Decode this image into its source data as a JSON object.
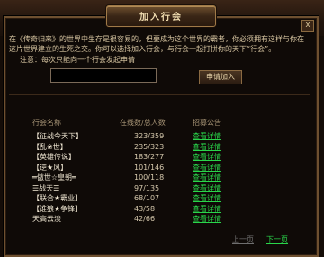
{
  "dialog": {
    "title": "加入行会",
    "close_label": "x",
    "intro_text": "在《传奇归来》的世界中生存是很容易的，但要成为这个世界的霸者，你必须拥有这样与你在这片世界建立的生死之交。你可以选择加入行会，与行会一起打拼你的天下“行会”。",
    "notice_text": "注意：每次只能向一个行会发起申请"
  },
  "application": {
    "input_value": "",
    "button_label": "申请加入"
  },
  "table": {
    "headers": {
      "name": "行会名称",
      "count": "在线数/总人数",
      "announcement": "招募公告"
    },
    "rows": [
      {
        "name": "【征战今天下】",
        "count": "323/359",
        "link": "查看详情"
      },
      {
        "name": "【乱❀世】",
        "count": "235/323",
        "link": "查看详情"
      },
      {
        "name": "【英雄传说】",
        "count": "183/277",
        "link": "查看详情"
      },
      {
        "name": "【逆★风】",
        "count": "101/146",
        "link": "查看详情"
      },
      {
        "name": "═傲世☆皇朝═",
        "count": "100/118",
        "link": "查看详情"
      },
      {
        "name": "☰战天☰",
        "count": "97/135",
        "link": "查看详情"
      },
      {
        "name": "【联合★霸业】",
        "count": "68/107",
        "link": "查看详情"
      },
      {
        "name": "【谁狼★争锋】",
        "count": "43/58",
        "link": "查看详情"
      },
      {
        "name": "天高云淡",
        "count": "42/66",
        "link": "查看详情"
      }
    ]
  },
  "pagination": {
    "prev_label": "上一页",
    "next_label": "下一页",
    "prev_color": "#6f6f6f",
    "next_color": "#29d64a"
  },
  "colors": {
    "link_green": "#29d64a",
    "frame_border": "#6e5030",
    "title_text": "#f3dfb2"
  }
}
